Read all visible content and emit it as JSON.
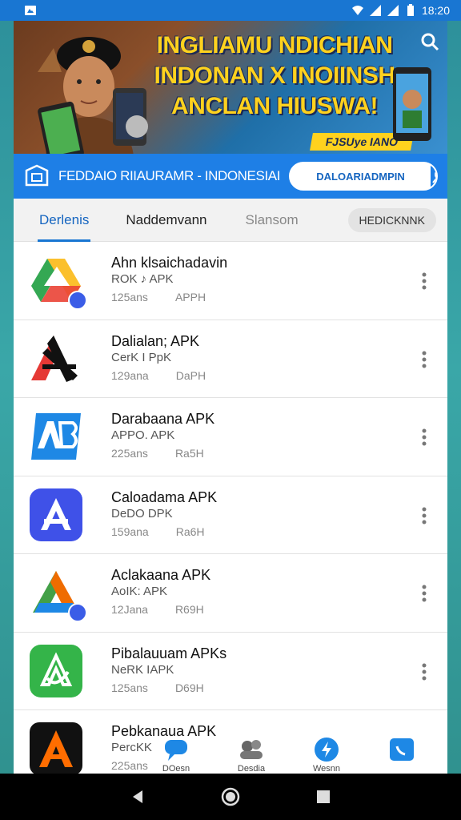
{
  "status_bar": {
    "time": "18:20",
    "icons": [
      "notification-icon",
      "wifi-icon",
      "signal-icon",
      "signal-icon",
      "battery-icon"
    ]
  },
  "banner": {
    "lines": [
      "INGLIAMU NDICHIAN",
      "INDONAN X INOIINSH",
      "ANCLAN HIUSWA!"
    ],
    "tag": "FJSUye IANO",
    "colors": {
      "text": "#ffd21e",
      "outline": "#1b2a55"
    }
  },
  "header": {
    "title": "FEDDAIO RIIAURAMR - INDONESIAI",
    "search_value": "DALOARIADMPIN",
    "accent": "#1e7fe6"
  },
  "tabs": {
    "items": [
      "Derlenis",
      "Naddemvann",
      "Slansom"
    ],
    "pill": "HEDICKNNK",
    "active": 0
  },
  "apps": [
    {
      "name": "Ahn klsaichadavin",
      "sub": "ROK ♪ APK",
      "count": "125ans",
      "type": "APPH",
      "icon": "google-drive-icon"
    },
    {
      "name": "Dalialan; APK",
      "sub": "CerK I PpK",
      "count": "129ana",
      "type": "DaPH",
      "icon": "triangle-logo-icon"
    },
    {
      "name": "Darabaana APK",
      "sub": "APPO. APK",
      "count": "225ans",
      "type": "Ra5H",
      "icon": "ab-logo-icon"
    },
    {
      "name": "Caloadama APK",
      "sub": "DeDO DPK",
      "count": "159ana",
      "type": "Ra6H",
      "icon": "app-store-icon"
    },
    {
      "name": "Aclakaana APK",
      "sub": "AoIK: APK",
      "count": "12Jana",
      "type": "R69H",
      "icon": "drive-triangle-icon"
    },
    {
      "name": "Pibalauuam APKs",
      "sub": "NeRK IAPK",
      "count": "125ans",
      "type": "D69H",
      "icon": "green-app-icon"
    },
    {
      "name": "Pebkanaua APK",
      "sub": "PercKK",
      "count": "225ans",
      "type": "",
      "icon": "orange-a-icon"
    }
  ],
  "bottom_nav": [
    {
      "label": "DOesn",
      "icon": "chat-icon"
    },
    {
      "label": "Desdia",
      "icon": "group-icon"
    },
    {
      "label": "Wesnn",
      "icon": "shield-icon"
    },
    {
      "label": "",
      "icon": "phone-icon"
    }
  ]
}
